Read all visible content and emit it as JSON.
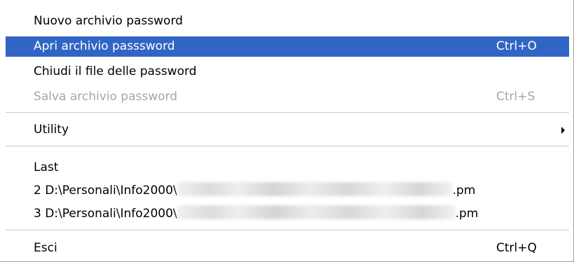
{
  "menu": {
    "items": [
      {
        "label": "Nuovo archivio password",
        "shortcut": "",
        "state": "normal"
      },
      {
        "label": "Apri archivio passsword",
        "shortcut": "Ctrl+O",
        "state": "highlighted"
      },
      {
        "label": "Chiudi il file delle password",
        "shortcut": "",
        "state": "normal"
      },
      {
        "label": "Salva archivio password",
        "shortcut": "Ctrl+S",
        "state": "disabled"
      },
      {
        "label": "Utility",
        "shortcut": "",
        "state": "submenu"
      },
      {
        "label": "Last",
        "shortcut": "",
        "state": "normal"
      },
      {
        "label_prefix": "2 D:\\Personali\\Info2000\\",
        "label_suffix": ".pm",
        "state": "normal"
      },
      {
        "label_prefix": "3 D:\\Personali\\Info2000\\",
        "label_suffix": ".pm",
        "state": "normal"
      },
      {
        "label": "Esci",
        "shortcut": "Ctrl+Q",
        "state": "normal"
      }
    ]
  },
  "colors": {
    "highlight": "#3165c5",
    "disabled_text": "#a6a6a6"
  },
  "icons": {
    "submenu": "triangle-right"
  }
}
